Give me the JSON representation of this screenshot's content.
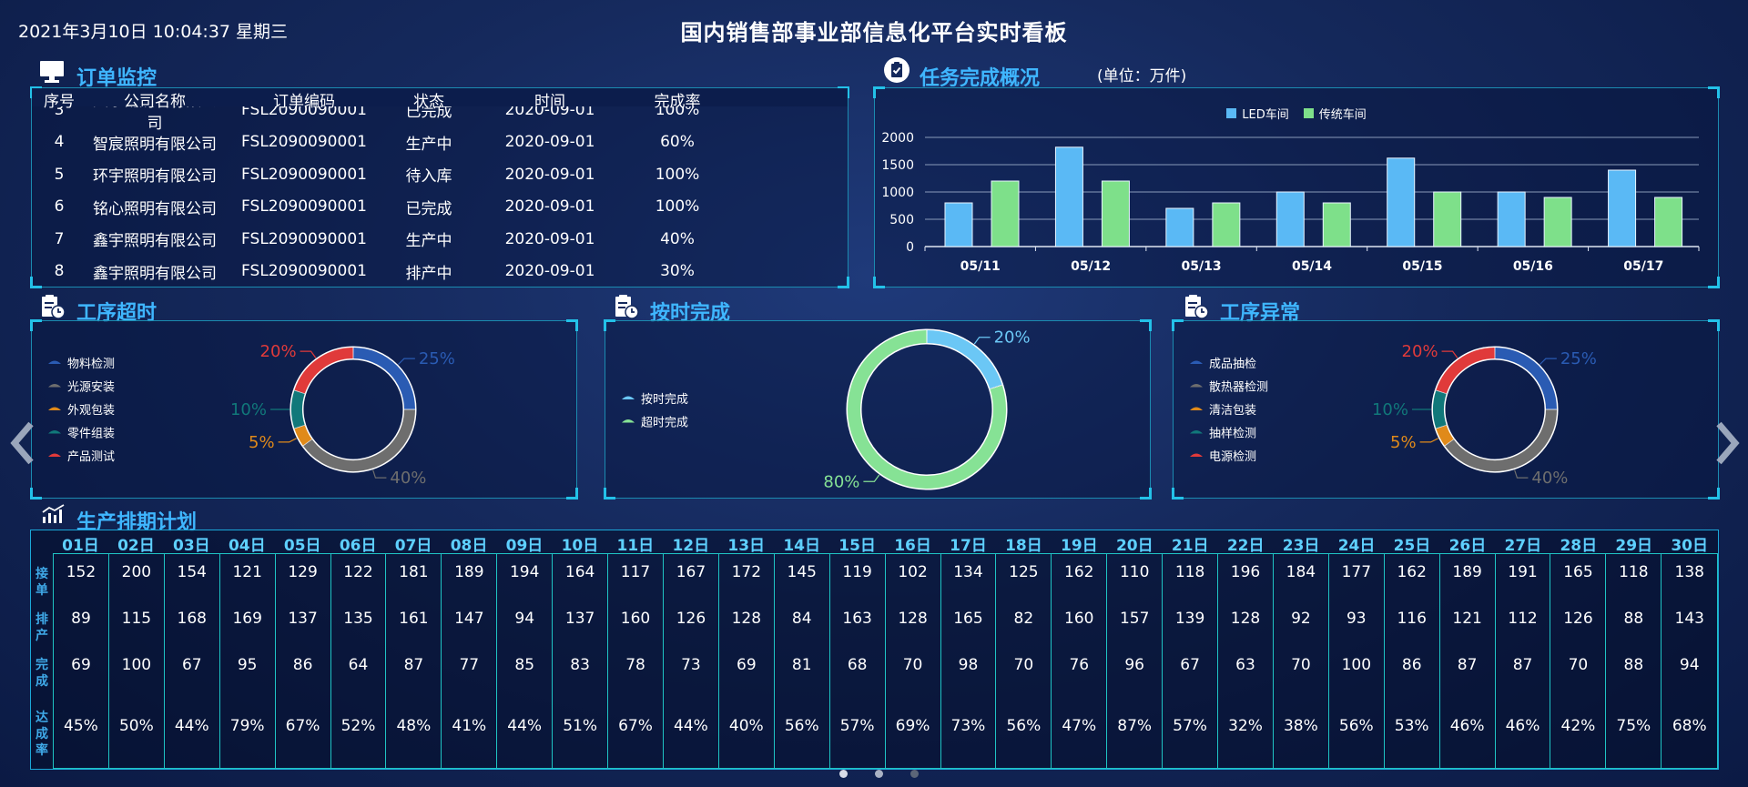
{
  "header": {
    "datetime": "2021年3月10日 10:04:37 星期三",
    "title": "国内销售部事业部信息化平台实时看板"
  },
  "orders": {
    "title": "订单监控",
    "columns": [
      "序号",
      "公司名称",
      "订单编码",
      "状态",
      "时间",
      "完成率"
    ],
    "rows": [
      [
        "3",
        "天乐南照明有限公司",
        "FSL2090090001",
        "已完成",
        "2020-09-01",
        "100%"
      ],
      [
        "4",
        "智宸照明有限公司",
        "FSL2090090001",
        "生产中",
        "2020-09-01",
        "60%"
      ],
      [
        "5",
        "环宇照明有限公司",
        "FSL2090090001",
        "待入库",
        "2020-09-01",
        "100%"
      ],
      [
        "6",
        "铭心照明有限公司",
        "FSL2090090001",
        "已完成",
        "2020-09-01",
        "100%"
      ],
      [
        "7",
        "鑫宇照明有限公司",
        "FSL2090090001",
        "生产中",
        "2020-09-01",
        "40%"
      ],
      [
        "8",
        "鑫宇照明有限公司",
        "FSL2090090001",
        "排产中",
        "2020-09-01",
        "30%"
      ]
    ]
  },
  "tasks": {
    "title": "任务完成概况",
    "unit": "(单位：万件)",
    "chart_data": {
      "type": "bar",
      "categories": [
        "05/11",
        "05/12",
        "05/13",
        "05/14",
        "05/15",
        "05/16",
        "05/17"
      ],
      "series": [
        {
          "name": "LED车间",
          "color": "#5ab9f5",
          "values": [
            800,
            1820,
            700,
            1000,
            1620,
            1000,
            1400
          ]
        },
        {
          "name": "传统车间",
          "color": "#7ee08a",
          "values": [
            1200,
            1200,
            800,
            800,
            1000,
            900,
            900
          ]
        }
      ],
      "yticks": [
        0,
        500,
        1000,
        1500,
        2000
      ],
      "ylim": [
        0,
        2000
      ],
      "legend": "top-center",
      "grid": true
    }
  },
  "timeout": {
    "title": "工序超时",
    "chart_data": {
      "type": "pie",
      "labels": [
        "物料检测",
        "光源安装",
        "外观包装",
        "零件组装",
        "产品测试"
      ],
      "values": [
        25,
        40,
        5,
        10,
        20
      ],
      "value_labels": [
        "25%",
        "40%",
        "5%",
        "10%",
        "20%"
      ],
      "colors": [
        "#2a5bb3",
        "#6e6e6e",
        "#e08a1a",
        "#11787a",
        "#e03a3a"
      ]
    }
  },
  "ontime": {
    "title": "按时完成",
    "chart_data": {
      "type": "pie",
      "labels": [
        "按时完成",
        "超时完成"
      ],
      "values": [
        20,
        80
      ],
      "value_labels": [
        "20%",
        "80%"
      ],
      "colors": [
        "#6bc7f5",
        "#86e295"
      ]
    }
  },
  "abnormal": {
    "title": "工序异常",
    "chart_data": {
      "type": "pie",
      "labels": [
        "成品抽检",
        "散热器检测",
        "清洁包装",
        "抽样检测",
        "电源检测"
      ],
      "values": [
        25,
        40,
        5,
        10,
        20
      ],
      "value_labels": [
        "25%",
        "40%",
        "5%",
        "10%",
        "20%"
      ],
      "colors": [
        "#2a5bb3",
        "#6e6e6e",
        "#e08a1a",
        "#11787a",
        "#e03a3a"
      ]
    }
  },
  "schedule": {
    "title": "生产排期计划",
    "row_labels": [
      "接单",
      "排产",
      "完成",
      "达成率"
    ],
    "days": [
      "01日",
      "02日",
      "03日",
      "04日",
      "05日",
      "06日",
      "07日",
      "08日",
      "09日",
      "10日",
      "11日",
      "12日",
      "13日",
      "14日",
      "15日",
      "16日",
      "17日",
      "18日",
      "19日",
      "20日",
      "21日",
      "22日",
      "23日",
      "24日",
      "25日",
      "26日",
      "27日",
      "28日",
      "29日",
      "30日"
    ],
    "received": [
      "152",
      "200",
      "154",
      "121",
      "129",
      "122",
      "181",
      "189",
      "194",
      "164",
      "117",
      "167",
      "172",
      "145",
      "119",
      "102",
      "134",
      "125",
      "162",
      "110",
      "118",
      "196",
      "184",
      "177",
      "162",
      "189",
      "191",
      "165",
      "118",
      "138"
    ],
    "scheduled": [
      "89",
      "115",
      "168",
      "169",
      "137",
      "135",
      "161",
      "147",
      "94",
      "137",
      "160",
      "126",
      "128",
      "84",
      "163",
      "128",
      "165",
      "82",
      "160",
      "157",
      "139",
      "128",
      "92",
      "93",
      "116",
      "121",
      "112",
      "126",
      "88",
      "143"
    ],
    "completed": [
      "69",
      "100",
      "67",
      "95",
      "86",
      "64",
      "87",
      "77",
      "85",
      "83",
      "78",
      "73",
      "69",
      "81",
      "68",
      "70",
      "98",
      "70",
      "76",
      "96",
      "67",
      "63",
      "70",
      "100",
      "86",
      "87",
      "87",
      "70",
      "88",
      "94"
    ],
    "rate": [
      "45%",
      "50%",
      "44%",
      "79%",
      "67%",
      "52%",
      "48%",
      "41%",
      "44%",
      "51%",
      "67%",
      "44%",
      "40%",
      "56%",
      "57%",
      "69%",
      "73%",
      "56%",
      "47%",
      "87%",
      "57%",
      "32%",
      "38%",
      "56%",
      "53%",
      "46%",
      "46%",
      "42%",
      "75%",
      "68%"
    ]
  },
  "nav": {
    "prev_icon": "chevron-left-icon",
    "next_icon": "chevron-right-icon"
  },
  "pager": {
    "count": 3,
    "active": 0
  }
}
